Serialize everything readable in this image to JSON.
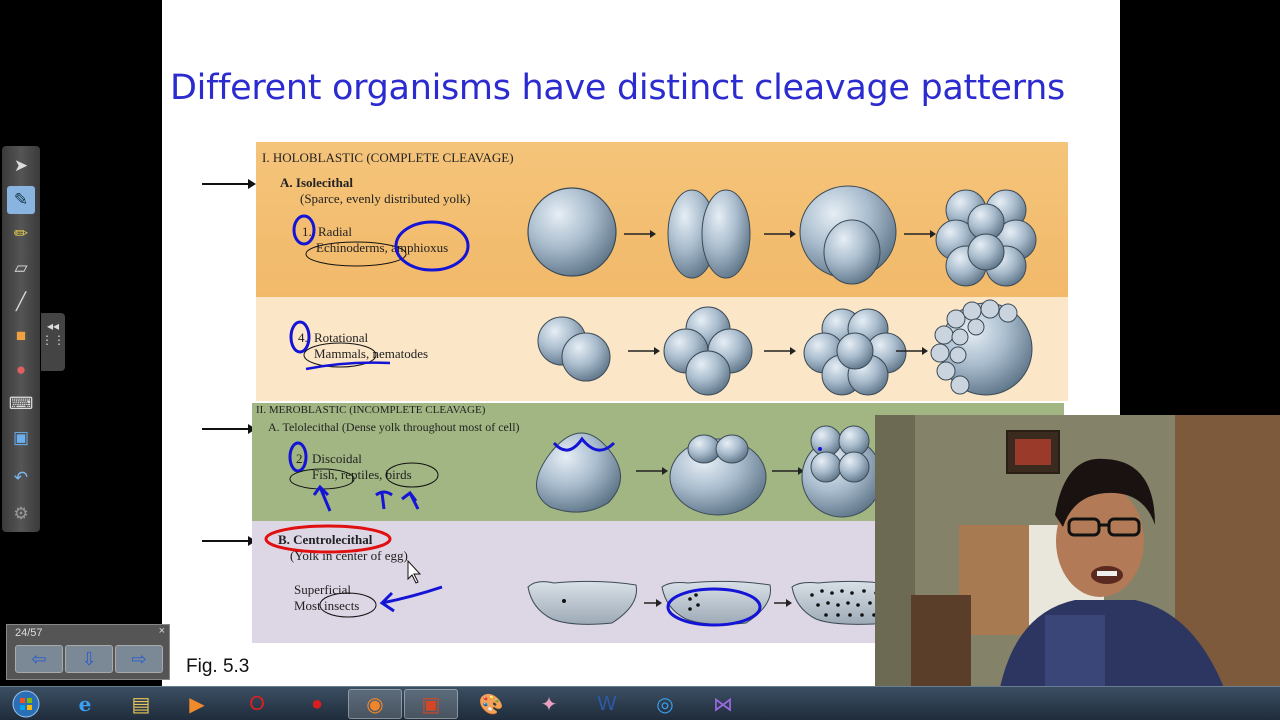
{
  "slide": {
    "title": "Different organisms have distinct cleavage patterns",
    "figure_label": "Fig. 5.3",
    "holoblastic": {
      "heading": "I.  HOLOBLASTIC (COMPLETE CLEAVAGE)",
      "sub_a": "A.  Isolecithal",
      "sub_a_desc": "(Sparce, evenly distributed yolk)",
      "item1_num": "1.",
      "item1_name": "Radial",
      "item1_examples": "Echinoderms, amphioxus",
      "item4_num": "4.",
      "item4_name": "Rotational",
      "item4_examples": "Mammals, nematodes"
    },
    "meroblastic": {
      "heading": "II.  MEROBLASTIC (INCOMPLETE CLEAVAGE)",
      "sub_a": "A.  Telolecithal  (Dense yolk throughout most of cell)",
      "item2_num": "2.",
      "item2_name": "Discoidal",
      "item2_examples": "Fish, reptiles, birds",
      "sub_b": "B.  Centrolecithal",
      "sub_b_desc": "(Yolk in center of egg)",
      "item_sup_name": "Superficial",
      "item_sup_examples": "Most insects"
    }
  },
  "pager": {
    "page": "24/57",
    "close": "×"
  },
  "toolbar_icons": [
    "select-arrow-icon",
    "pen-icon",
    "highlighter-icon",
    "eraser-icon",
    "line-icon",
    "shapes-icon",
    "magic-pen-icon",
    "keyboard-icon",
    "screen-capture-icon",
    "undo-icon",
    "settings-icon"
  ],
  "taskbar_icons": [
    "start-orb-icon",
    "internet-explorer-icon",
    "file-explorer-icon",
    "media-player-icon",
    "opera-icon",
    "red-app-icon",
    "firefox-icon",
    "powerpoint-icon",
    "paint-icon",
    "character-app-icon",
    "word-icon",
    "camera-app-icon",
    "visual-studio-icon"
  ],
  "colors": {
    "title": "#2b2bd0",
    "ink_blue": "#1414d6",
    "ink_red": "#e01010",
    "band_orange": "#f2b96a",
    "band_cream": "#fbe6c7",
    "band_green": "#a2b683",
    "band_lavender": "#ddd6e4"
  }
}
